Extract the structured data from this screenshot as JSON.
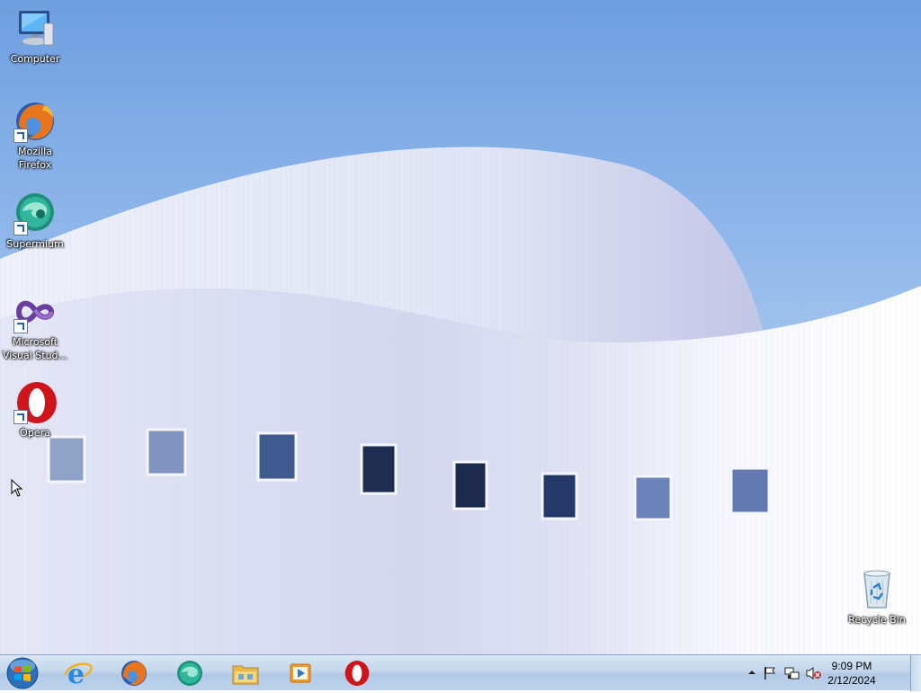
{
  "desktop": {
    "icons": [
      {
        "label": "Computer",
        "icon": "computer-icon"
      },
      {
        "label": "Mozilla Firefox",
        "icon": "firefox-icon"
      },
      {
        "label": "Supermium",
        "icon": "supermium-icon"
      },
      {
        "label": "Microsoft Visual Stud...",
        "icon": "visual-studio-icon"
      },
      {
        "label": "Opera",
        "icon": "opera-icon"
      },
      {
        "label": "Recycle Bin",
        "icon": "recycle-bin-icon"
      }
    ]
  },
  "taskbar": {
    "start_icon": "windows-logo-icon",
    "pinned": [
      {
        "icon": "internet-explorer-icon"
      },
      {
        "icon": "firefox-icon"
      },
      {
        "icon": "supermium-icon"
      },
      {
        "icon": "file-explorer-icon"
      },
      {
        "icon": "media-player-icon"
      },
      {
        "icon": "opera-icon"
      }
    ],
    "tray": {
      "icons": [
        "show-hidden-icons-chevron",
        "action-center-flag-icon",
        "network-icon",
        "volume-muted-icon"
      ],
      "time": "9:09 PM",
      "date": "2/12/2024"
    }
  },
  "colors": {
    "sky": "#8fb6ea",
    "taskbar": "#c3d6ec",
    "opera_red": "#d0141b",
    "firefox_orange": "#e8741c"
  }
}
